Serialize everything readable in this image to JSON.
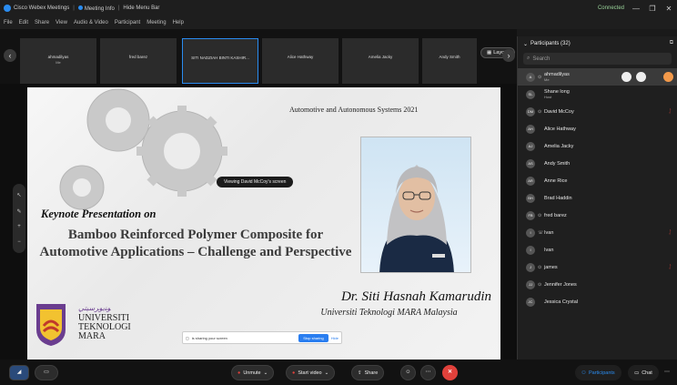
{
  "titlebar": {
    "app": "Cisco Webex Meetings",
    "meeting_label": "Meeting Info",
    "menu_label": "Hide Menu Bar",
    "connected": "Connected",
    "win_minimize": "—",
    "win_restore": "❐",
    "win_close": "✕"
  },
  "menubar": [
    "File",
    "Edit",
    "Share",
    "View",
    "Audio & Video",
    "Participant",
    "Meeting",
    "Help"
  ],
  "strip": {
    "tiles": [
      {
        "name": "ahmadilyas",
        "sub": "Me"
      },
      {
        "name": "fred barez",
        "sub": ""
      },
      {
        "name": "SITI NADZIAH BINTI KASHIR...",
        "sub": ""
      },
      {
        "name": "Alice Hathway",
        "sub": ""
      },
      {
        "name": "Amelia Jacky",
        "sub": ""
      },
      {
        "name": "Andy Smith",
        "sub": ""
      }
    ],
    "layout_label": "Layout"
  },
  "stage": {
    "viewing_label": "Viewing David McCoy's screen",
    "conference_title": "Automotive and Autonomous Systems 2021",
    "keynote": "Keynote Presentation on",
    "title": "Bamboo Reinforced Polymer Composite for Automotive Applications – Challenge and Perspective",
    "speaker": "Dr. Siti Hasnah Kamarudin",
    "affiliation": "Universiti Teknologi MARA Malaysia",
    "uni_lines": [
      "UNIVERSITI",
      "TEKNOLOGI",
      "MARA"
    ],
    "share_bar": {
      "text": "is sharing your screen",
      "stop": "Stop sharing",
      "hide": "Hide"
    }
  },
  "panel": {
    "title": "Participants (32)",
    "search_placeholder": "Search",
    "participants": [
      {
        "name": "ahmadilyas",
        "role": "Me",
        "initials": "A",
        "muted": false,
        "highlight": true
      },
      {
        "name": "Shane long",
        "role": "Host",
        "initials": "SL",
        "muted": false,
        "highlight": false
      },
      {
        "name": "David McCoy",
        "role": "",
        "initials": "DM",
        "muted": true,
        "highlight": false
      },
      {
        "name": "Alice Hathway",
        "role": "",
        "initials": "AH",
        "muted": false,
        "highlight": false
      },
      {
        "name": "Amelia Jacky",
        "role": "",
        "initials": "AJ",
        "muted": false,
        "highlight": false
      },
      {
        "name": "Andy Smith",
        "role": "",
        "initials": "AS",
        "muted": false,
        "highlight": false
      },
      {
        "name": "Anne Rice",
        "role": "",
        "initials": "AR",
        "muted": false,
        "highlight": false
      },
      {
        "name": "Brad Haddin",
        "role": "",
        "initials": "BH",
        "muted": false,
        "highlight": false
      },
      {
        "name": "fred barez",
        "role": "",
        "initials": "FB",
        "muted": false,
        "highlight": false
      },
      {
        "name": "Ivan",
        "role": "",
        "initials": "I",
        "muted": true,
        "highlight": false
      },
      {
        "name": "Ivan",
        "role": "",
        "initials": "I",
        "muted": false,
        "highlight": false
      },
      {
        "name": "james",
        "role": "",
        "initials": "J",
        "muted": true,
        "highlight": false
      },
      {
        "name": "Jennifer Jones",
        "role": "",
        "initials": "JJ",
        "muted": false,
        "highlight": false
      },
      {
        "name": "Jessica Crystal",
        "role": "",
        "initials": "JC",
        "muted": false,
        "highlight": false
      }
    ]
  },
  "bottombar": {
    "unmute": "Unmute",
    "start_video": "Start video",
    "share": "Share",
    "participants": "Participants",
    "chat": "Chat"
  },
  "colors": {
    "accent": "#2a8cf0",
    "danger": "#e0413b",
    "background": "#1a1a1a"
  }
}
